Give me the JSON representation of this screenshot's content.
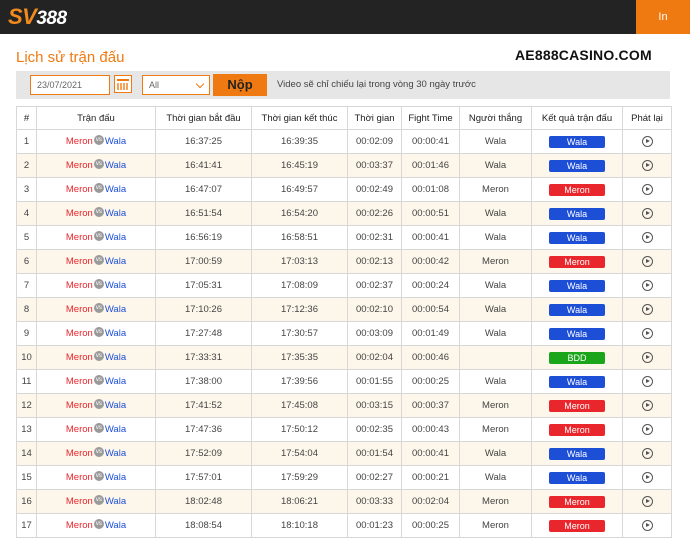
{
  "header": {
    "logo_sv": "SV",
    "logo_num": "388",
    "login_label": "In"
  },
  "page": {
    "title": "Lịch sử trận đấu",
    "watermark": "AE888CASINO.COM"
  },
  "filters": {
    "date_value": "23/07/2021",
    "select_value": "All",
    "submit_label": "Nộp",
    "note": "Video sẽ chỉ chiếu lại trong vòng 30 ngày trước"
  },
  "colors": {
    "accent": "#f07a12",
    "meron": "#e8262c",
    "wala": "#1d4fd6",
    "bdd": "#1aa51a"
  },
  "table": {
    "columns": [
      "#",
      "Trận đấu",
      "Thời gian bắt đầu",
      "Thời gian kết thúc",
      "Thời gian",
      "Fight Time",
      "Người thắng",
      "Kết quả trận đấu",
      "Phát lại"
    ],
    "match_left": "Meron",
    "match_vs": "vs",
    "match_right": "Wala",
    "rows": [
      {
        "no": "1",
        "start": "16:37:25",
        "end": "16:39:35",
        "duration": "00:02:09",
        "fight": "00:00:41",
        "winner": "Wala",
        "result": "Wala",
        "result_type": "wala"
      },
      {
        "no": "2",
        "start": "16:41:41",
        "end": "16:45:19",
        "duration": "00:03:37",
        "fight": "00:01:46",
        "winner": "Wala",
        "result": "Wala",
        "result_type": "wala"
      },
      {
        "no": "3",
        "start": "16:47:07",
        "end": "16:49:57",
        "duration": "00:02:49",
        "fight": "00:01:08",
        "winner": "Meron",
        "result": "Meron",
        "result_type": "meron"
      },
      {
        "no": "4",
        "start": "16:51:54",
        "end": "16:54:20",
        "duration": "00:02:26",
        "fight": "00:00:51",
        "winner": "Wala",
        "result": "Wala",
        "result_type": "wala"
      },
      {
        "no": "5",
        "start": "16:56:19",
        "end": "16:58:51",
        "duration": "00:02:31",
        "fight": "00:00:41",
        "winner": "Wala",
        "result": "Wala",
        "result_type": "wala"
      },
      {
        "no": "6",
        "start": "17:00:59",
        "end": "17:03:13",
        "duration": "00:02:13",
        "fight": "00:00:42",
        "winner": "Meron",
        "result": "Meron",
        "result_type": "meron"
      },
      {
        "no": "7",
        "start": "17:05:31",
        "end": "17:08:09",
        "duration": "00:02:37",
        "fight": "00:00:24",
        "winner": "Wala",
        "result": "Wala",
        "result_type": "wala"
      },
      {
        "no": "8",
        "start": "17:10:26",
        "end": "17:12:36",
        "duration": "00:02:10",
        "fight": "00:00:54",
        "winner": "Wala",
        "result": "Wala",
        "result_type": "wala"
      },
      {
        "no": "9",
        "start": "17:27:48",
        "end": "17:30:57",
        "duration": "00:03:09",
        "fight": "00:01:49",
        "winner": "Wala",
        "result": "Wala",
        "result_type": "wala"
      },
      {
        "no": "10",
        "start": "17:33:31",
        "end": "17:35:35",
        "duration": "00:02:04",
        "fight": "00:00:46",
        "winner": "",
        "result": "BDD",
        "result_type": "bdd"
      },
      {
        "no": "11",
        "start": "17:38:00",
        "end": "17:39:56",
        "duration": "00:01:55",
        "fight": "00:00:25",
        "winner": "Wala",
        "result": "Wala",
        "result_type": "wala"
      },
      {
        "no": "12",
        "start": "17:41:52",
        "end": "17:45:08",
        "duration": "00:03:15",
        "fight": "00:00:37",
        "winner": "Meron",
        "result": "Meron",
        "result_type": "meron"
      },
      {
        "no": "13",
        "start": "17:47:36",
        "end": "17:50:12",
        "duration": "00:02:35",
        "fight": "00:00:43",
        "winner": "Meron",
        "result": "Meron",
        "result_type": "meron"
      },
      {
        "no": "14",
        "start": "17:52:09",
        "end": "17:54:04",
        "duration": "00:01:54",
        "fight": "00:00:41",
        "winner": "Wala",
        "result": "Wala",
        "result_type": "wala"
      },
      {
        "no": "15",
        "start": "17:57:01",
        "end": "17:59:29",
        "duration": "00:02:27",
        "fight": "00:00:21",
        "winner": "Wala",
        "result": "Wala",
        "result_type": "wala"
      },
      {
        "no": "16",
        "start": "18:02:48",
        "end": "18:06:21",
        "duration": "00:03:33",
        "fight": "00:02:04",
        "winner": "Meron",
        "result": "Meron",
        "result_type": "meron"
      },
      {
        "no": "17",
        "start": "18:08:54",
        "end": "18:10:18",
        "duration": "00:01:23",
        "fight": "00:00:25",
        "winner": "Meron",
        "result": "Meron",
        "result_type": "meron"
      }
    ]
  }
}
